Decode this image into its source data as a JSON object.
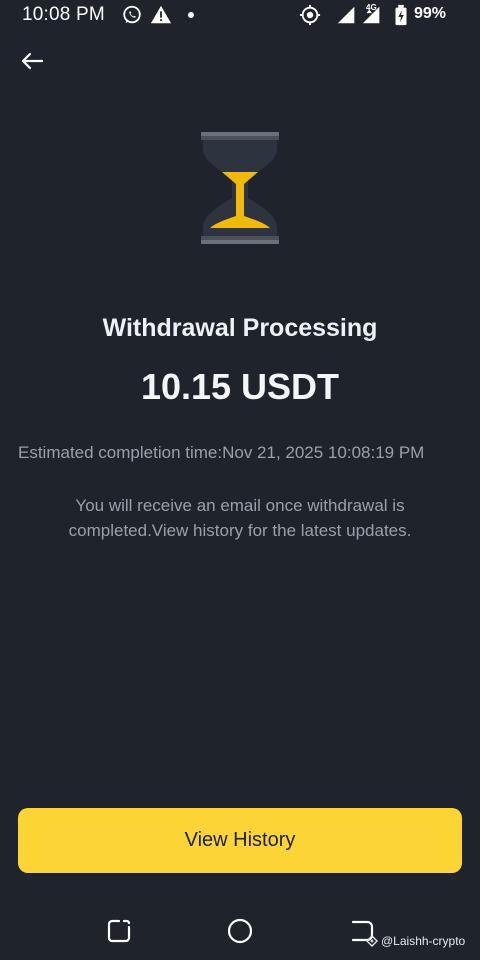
{
  "status_bar": {
    "time": "10:08 PM",
    "battery": "99%",
    "network_label": "4G",
    "icons": [
      "whatsapp-icon",
      "warning-icon",
      "dot-icon",
      "vpn-icon",
      "signal-icon",
      "signal-icon",
      "battery-icon"
    ]
  },
  "header": {
    "back_icon": "back-arrow-icon"
  },
  "status_card": {
    "icon": "hourglass-icon",
    "title": "Withdrawal Processing",
    "amount": "10.15 USDT",
    "estimate_text": "Estimated completion time:Nov 21, 2025 10:08:19 PM",
    "notice_text": "You will receive an email once withdrawal is completed.View history for the latest updates."
  },
  "actions": {
    "view_history_label": "View History"
  },
  "nav_bar": {
    "icons": [
      "recent-apps-icon",
      "home-icon",
      "back-icon"
    ]
  },
  "watermark": {
    "text": "@Laishh-crypto"
  },
  "colors": {
    "background": "#1f232c",
    "accent": "#fcd436",
    "text_primary": "#eef1f4",
    "text_secondary": "#9aa0ab"
  }
}
